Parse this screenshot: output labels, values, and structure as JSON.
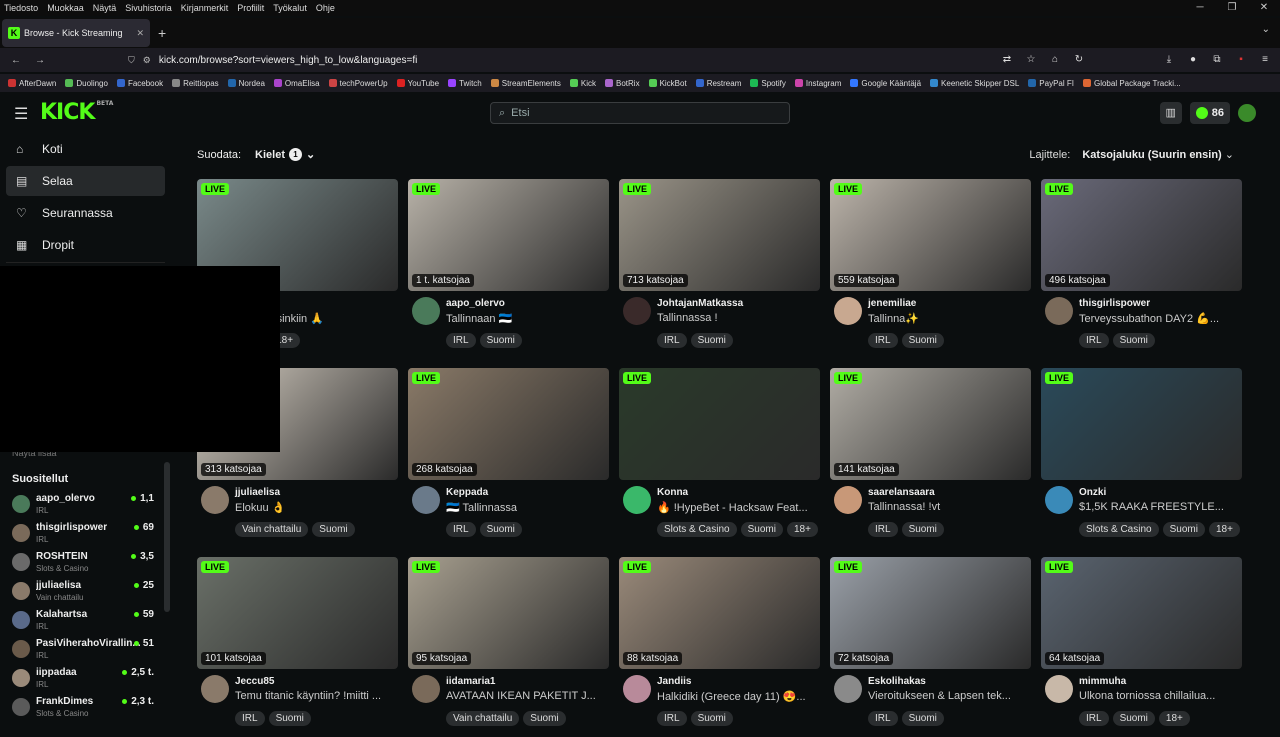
{
  "menubar": [
    "Tiedosto",
    "Muokkaa",
    "Näytä",
    "Sivuhistoria",
    "Kirjanmerkit",
    "Profiilit",
    "Työkalut",
    "Ohje"
  ],
  "tab": {
    "title": "Browse - Kick Streaming",
    "favicon": "K"
  },
  "url": "kick.com/browse?sort=viewers_high_to_low&languages=fi",
  "bookmarks": [
    "AfterDawn",
    "Duolingo",
    "Facebook",
    "Reittiopas",
    "Nordea",
    "OmaElisa",
    "techPowerUp",
    "YouTube",
    "Twitch",
    "StreamElements",
    "Kick",
    "BotRix",
    "KickBot",
    "Restream",
    "Spotify",
    "Instagram",
    "Google Kääntäjä",
    "Keenetic Skipper DSL",
    "PayPal FI",
    "Global Package Tracki..."
  ],
  "header": {
    "logo": "KICK",
    "logo_beta": "BETA",
    "search_placeholder": "Etsi",
    "coins": "86"
  },
  "nav": [
    {
      "label": "Koti",
      "icon": "home-icon",
      "glyph": "⌂"
    },
    {
      "label": "Selaa",
      "icon": "browse-icon",
      "glyph": "▤"
    },
    {
      "label": "Seurannassa",
      "icon": "heart-icon",
      "glyph": "♡"
    },
    {
      "label": "Dropit",
      "icon": "gift-icon",
      "glyph": "▦"
    }
  ],
  "sidebar": {
    "show_more": "Näytä lisää",
    "suggested_title": "Suositellut",
    "suggested": [
      {
        "name": "aapo_olervo",
        "category": "IRL",
        "viewers": "1,1",
        "color": "#4a7a5a"
      },
      {
        "name": "thisgirlispower",
        "category": "IRL",
        "viewers": "69",
        "color": "#7a6a5a"
      },
      {
        "name": "ROSHTEIN",
        "category": "Slots & Casino",
        "viewers": "3,5",
        "color": "#6a6a6a"
      },
      {
        "name": "jjuliaelisa",
        "category": "Vain chattailu",
        "viewers": "25",
        "color": "#8a7a6a"
      },
      {
        "name": "Kalahartsa",
        "category": "IRL",
        "viewers": "59",
        "color": "#5a6a8a"
      },
      {
        "name": "PasiViherahoVirallin...",
        "category": "IRL",
        "viewers": "51",
        "color": "#6a5a4a"
      },
      {
        "name": "iippadaa",
        "category": "IRL",
        "viewers": "2,5 t.",
        "color": "#9a8a7a"
      },
      {
        "name": "FrankDimes",
        "category": "Slots & Casino",
        "viewers": "2,3 t.",
        "color": "#5a5a5a"
      }
    ]
  },
  "filter": {
    "label": "Suodata:",
    "languages": "Kielet",
    "count": "1"
  },
  "sort": {
    "label": "Lajittele:",
    "value": "Katsojaluku (Suurin ensin)"
  },
  "live_label": "LIVE",
  "streams": [
    {
      "name": "",
      "title": "tuloa helsinkiin 🙏",
      "viewers": "",
      "tags": [
        "omi",
        "18+"
      ],
      "thumb": "#7a8a8a",
      "avatar": "#aa8866"
    },
    {
      "name": "aapo_olervo",
      "title": "Tallinnaan 🇪🇪",
      "viewers": "1 t. katsojaa",
      "tags": [
        "IRL",
        "Suomi"
      ],
      "thumb": "#b8b2a8",
      "avatar": "#4a7a5a"
    },
    {
      "name": "JohtajanMatkassa",
      "title": "Tallinnassa !",
      "viewers": "713 katsojaa",
      "tags": [
        "IRL",
        "Suomi"
      ],
      "thumb": "#9a9488",
      "avatar": "#3a2a2a"
    },
    {
      "name": "jenemiliae",
      "title": "Tallinna✨",
      "viewers": "559 katsojaa",
      "tags": [
        "IRL",
        "Suomi"
      ],
      "thumb": "#bcb4aa",
      "avatar": "#c8a890"
    },
    {
      "name": "thisgirlispower",
      "title": "Terveyssubathon DAY2 💪...",
      "viewers": "496 katsojaa",
      "tags": [
        "IRL",
        "Suomi"
      ],
      "thumb": "#6a6a7a",
      "avatar": "#7a6a5a"
    },
    {
      "name": "jjuliaelisa",
      "title": "Elokuu 👌",
      "viewers": "313 katsojaa",
      "tags": [
        "Vain chattailu",
        "Suomi"
      ],
      "thumb": "#d8d0c4",
      "avatar": "#8a7a6a"
    },
    {
      "name": "Keppada",
      "title": "🇪🇪 Tallinnassa",
      "viewers": "268 katsojaa",
      "tags": [
        "IRL",
        "Suomi"
      ],
      "thumb": "#8a7a68",
      "avatar": "#6a7a8a"
    },
    {
      "name": "Konna",
      "title": "🔥 !HypeBet - Hacksaw Feat...",
      "viewers": "",
      "tags": [
        "Slots & Casino",
        "Suomi",
        "18+"
      ],
      "thumb": "#2a3a2a",
      "avatar": "#3ab86a"
    },
    {
      "name": "saarelansaara",
      "title": "Tallinnassa! !vt",
      "viewers": "141 katsojaa",
      "tags": [
        "IRL",
        "Suomi"
      ],
      "thumb": "#b0aca4",
      "avatar": "#c89878"
    },
    {
      "name": "Onzki",
      "title": "$1,5K RAAKA FREESTYLE...",
      "viewers": "",
      "tags": [
        "Slots & Casino",
        "Suomi",
        "18+"
      ],
      "thumb": "#2a4a5a",
      "avatar": "#3a8ab8"
    },
    {
      "name": "Jeccu85",
      "title": "Temu titanic käyntiin? !miitti ...",
      "viewers": "101 katsojaa",
      "tags": [
        "IRL",
        "Suomi"
      ],
      "thumb": "#6a7068",
      "avatar": "#8a7a6a"
    },
    {
      "name": "iidamaria1",
      "title": "AVATAAN IKEAN PAKETIT J...",
      "viewers": "95 katsojaa",
      "tags": [
        "Vain chattailu",
        "Suomi"
      ],
      "thumb": "#a8a090",
      "avatar": "#7a6a5a"
    },
    {
      "name": "Jandiis",
      "title": "Halkidiki (Greece day 11) 😍...",
      "viewers": "88 katsojaa",
      "tags": [
        "IRL",
        "Suomi"
      ],
      "thumb": "#9a8a7a",
      "avatar": "#b88a9a"
    },
    {
      "name": "Eskolihakas",
      "title": "Vieroitukseen & Lapsen tek...",
      "viewers": "72 katsojaa",
      "tags": [
        "IRL",
        "Suomi"
      ],
      "thumb": "#9aa0a8",
      "avatar": "#8a8a8a"
    },
    {
      "name": "mimmuha",
      "title": "Ulkona torniossa chillailua...",
      "viewers": "64 katsojaa",
      "tags": [
        "IRL",
        "Suomi",
        "18+"
      ],
      "thumb": "#5a6470",
      "avatar": "#c8b8a8"
    }
  ]
}
